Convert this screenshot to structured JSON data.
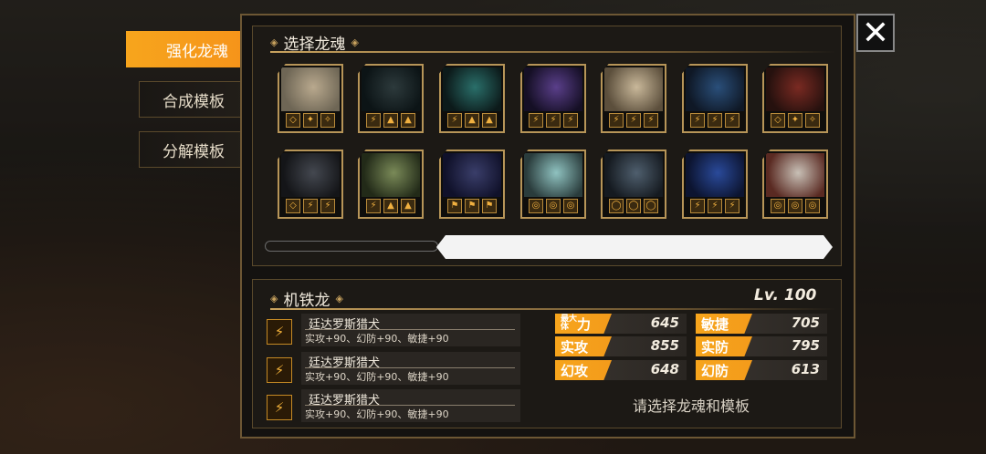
{
  "tabs": [
    {
      "label": "强化龙魂",
      "active": true
    },
    {
      "label": "合成模板",
      "active": false
    },
    {
      "label": "分解模板",
      "active": false
    }
  ],
  "select_panel": {
    "title": "选择龙魂"
  },
  "close_label": "✕",
  "cards": [
    {
      "art": [
        "#b9a98e",
        "#6e6655"
      ],
      "slots": [
        "◇",
        "✦",
        "✧"
      ]
    },
    {
      "art": [
        "#2d3a3c",
        "#0c1416"
      ],
      "slots": [
        "⚡",
        "▲",
        "▲"
      ]
    },
    {
      "art": [
        "#2a6f6a",
        "#0c1a1a"
      ],
      "slots": [
        "⚡",
        "▲",
        "▲"
      ]
    },
    {
      "art": [
        "#5a3f8a",
        "#150f25"
      ],
      "slots": [
        "⚡",
        "⚡",
        "⚡"
      ]
    },
    {
      "art": [
        "#c9b89a",
        "#5c4f3c"
      ],
      "slots": [
        "⚡",
        "⚡",
        "⚡"
      ]
    },
    {
      "art": [
        "#2a4f7a",
        "#0f1826"
      ],
      "slots": [
        "⚡",
        "⚡",
        "⚡"
      ]
    },
    {
      "art": [
        "#7a2a22",
        "#26110e"
      ],
      "slots": [
        "◇",
        "✦",
        "✧"
      ]
    },
    {
      "art": [
        "#444850",
        "#141518"
      ],
      "slots": [
        "◇",
        "⚡",
        "⚡"
      ]
    },
    {
      "art": [
        "#7a8a58",
        "#222a18"
      ],
      "slots": [
        "⚡",
        "▲",
        "▲"
      ]
    },
    {
      "art": [
        "#3a3e6a",
        "#10112a"
      ],
      "slots": [
        "⚑",
        "⚑",
        "⚑"
      ]
    },
    {
      "art": [
        "#8fc2c0",
        "#2a3c3c"
      ],
      "slots": [
        "◎",
        "◎",
        "◎"
      ]
    },
    {
      "art": [
        "#4f5f6e",
        "#151a20"
      ],
      "slots": [
        "◯",
        "◯",
        "◯"
      ]
    },
    {
      "art": [
        "#2a4a9a",
        "#0c1430"
      ],
      "slots": [
        "⚡",
        "⚡",
        "⚡"
      ]
    },
    {
      "art": [
        "#c8c0b6",
        "#5a2a22"
      ],
      "slots": [
        "◎",
        "◎",
        "◎"
      ]
    }
  ],
  "detail": {
    "name": "机铁龙",
    "level": "Lv. 100",
    "skills": [
      {
        "icon": "⚡",
        "name": "廷达罗斯猎犬",
        "desc": "实攻+90、幻防+90、敏捷+90"
      },
      {
        "icon": "⚡",
        "name": "廷达罗斯猎犬",
        "desc": "实攻+90、幻防+90、敏捷+90"
      },
      {
        "icon": "⚡",
        "name": "廷达罗斯猎犬",
        "desc": "实攻+90、幻防+90、敏捷+90"
      }
    ],
    "stats": [
      {
        "label": "力",
        "prefix": "最大体",
        "value": "645"
      },
      {
        "label": "敏捷",
        "value": "705"
      },
      {
        "label": "实攻",
        "value": "855"
      },
      {
        "label": "实防",
        "value": "795"
      },
      {
        "label": "幻攻",
        "value": "648"
      },
      {
        "label": "幻防",
        "value": "613"
      }
    ],
    "hint": "请选择龙魂和模板"
  },
  "colors": {
    "accent": "#f7a51c",
    "gold": "#c8a25e"
  }
}
